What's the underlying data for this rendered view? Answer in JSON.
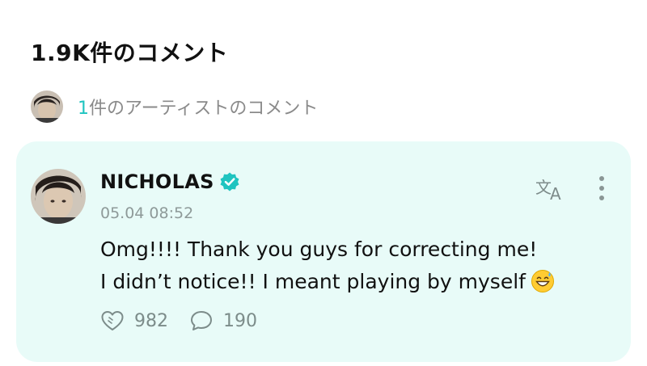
{
  "header": {
    "comment_count_title": "1.9K件のコメント"
  },
  "artist_summary": {
    "count": "1",
    "label": "件のアーティストのコメント"
  },
  "comment": {
    "author": "NICHOLAS",
    "verified": true,
    "timestamp": "05.04 08:52",
    "lines": [
      "Omg!!!! Thank you guys for correcting me!",
      "I didn’t notice!! I meant playing by myself"
    ],
    "emoji": "grinning-face-with-sweat",
    "likes": "982",
    "replies": "190"
  },
  "icons": {
    "verified": "verified-check-icon",
    "translate": "translate-icon",
    "more": "more-vertical-icon",
    "like": "heart-like-icon",
    "reply": "comment-bubble-icon"
  },
  "colors": {
    "accent": "#1fc4c0",
    "card_bg": "#e8fbf8",
    "muted": "#8a8a8a"
  }
}
